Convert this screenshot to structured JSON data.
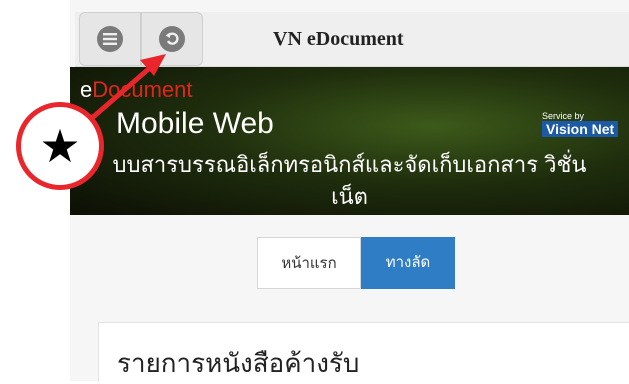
{
  "header": {
    "title": "VN eDocument",
    "menu_icon": "menu-icon",
    "back_icon": "back-icon"
  },
  "banner": {
    "brand_prefix": "e",
    "brand_suffix": "Document",
    "subtitle": "Mobile Web",
    "service_by": "Service by",
    "vendor": "Vision Net",
    "description_line1": "บบสารบรรณอิเล็กทรอนิกส์และจัดเก็บเอกสาร วิชั่น",
    "description_line2": "เน็ต"
  },
  "tabs": [
    {
      "label": "หน้าแรก",
      "active": false
    },
    {
      "label": "ทางลัด",
      "active": true
    }
  ],
  "card": {
    "title": "รายการหนังสือค้างรับ"
  },
  "annotation": {
    "glyph": "★",
    "icon": "star-icon",
    "color": "#e8262b"
  },
  "colors": {
    "accent": "#2f7ec5",
    "annotation_red": "#e8262b"
  }
}
